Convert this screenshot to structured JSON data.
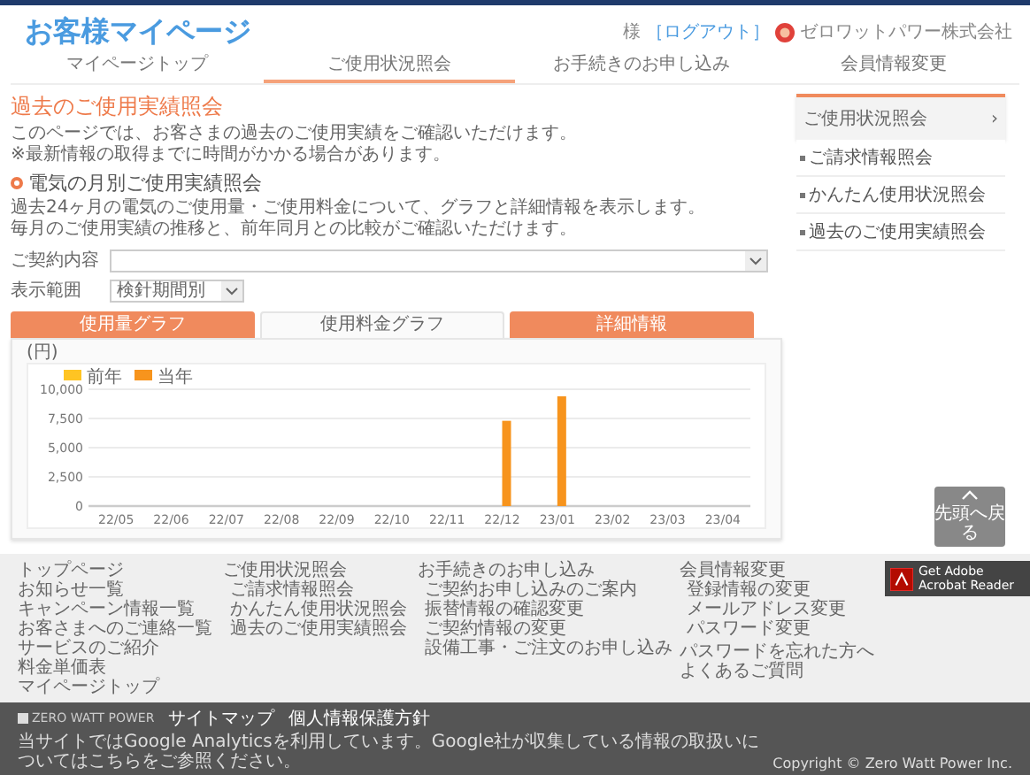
{
  "header": {
    "title": "お客様マイページ",
    "user_suffix": "様",
    "logout": "［ログアウト］",
    "company": "ゼロワットパワー株式会社"
  },
  "nav": [
    {
      "label": "マイページトップ",
      "selected": false
    },
    {
      "label": "ご使用状況照会",
      "selected": true
    },
    {
      "label": "お手続きのお申し込み",
      "selected": false
    },
    {
      "label": "会員情報変更",
      "selected": false
    }
  ],
  "page_title": "過去のご使用実績照会",
  "intro": [
    "このページでは、お客さまの過去のご使用実績をご確認いただけます。",
    "※最新情報の取得までに時間がかかる場合があります。"
  ],
  "section_title": "電気の月別ご使用実績照会",
  "section_text": [
    "過去24ヶ月の電気のご使用量・ご使用料金について、グラフと詳細情報を表示します。",
    "毎月のご使用実績の推移と、前年同月との比較がご確認いただけます。"
  ],
  "contract_select": {
    "label": "ご契約内容"
  },
  "range_select": {
    "label": "表示範囲",
    "value": "検針期間別"
  },
  "tabs": [
    {
      "label": "使用量グラフ",
      "selected": false
    },
    {
      "label": "使用料金グラフ",
      "selected": true
    },
    {
      "label": "詳細情報",
      "selected": false
    }
  ],
  "chart_unit": "(円)",
  "chart_data": {
    "type": "bar",
    "categories": [
      "22/05",
      "22/06",
      "22/07",
      "22/08",
      "22/09",
      "22/10",
      "22/11",
      "22/12",
      "23/01",
      "23/02",
      "23/03",
      "23/04"
    ],
    "series": [
      {
        "name": "前年",
        "color": "#ffc423",
        "values": [
          0,
          0,
          0,
          0,
          0,
          0,
          0,
          0,
          0,
          0,
          0,
          0
        ]
      },
      {
        "name": "当年",
        "color": "#f7941d",
        "values": [
          0,
          0,
          0,
          0,
          0,
          0,
          0,
          7300,
          9400,
          0,
          0,
          0
        ]
      }
    ],
    "ylim": [
      0,
      10000
    ],
    "grid": true,
    "yticks": [
      {
        "value": 0,
        "label": "0"
      },
      {
        "value": 2500,
        "label": "2,500"
      },
      {
        "value": 5000,
        "label": "5,000"
      },
      {
        "value": 7500,
        "label": "7,500"
      },
      {
        "value": 10000,
        "label": "10,000"
      }
    ]
  },
  "sidebar": {
    "title": "ご使用状況照会",
    "arrow": "›",
    "items": [
      "ご請求情報照会",
      "かんたん使用状況照会",
      "過去のご使用実績照会"
    ]
  },
  "back_to_top": "先頭へ戻る",
  "footer_columns": [
    {
      "links": [
        "トップページ",
        "お知らせ一覧",
        "キャンペーン情報一覧",
        "お客さまへのご連絡一覧",
        "サービスのご紹介",
        "料金単価表",
        "マイページトップ"
      ]
    },
    {
      "heading": "ご使用状況照会",
      "links": [
        "ご請求情報照会",
        "かんたん使用状況照会",
        "過去のご使用実績照会"
      ]
    },
    {
      "heading": "お手続きのお申し込み",
      "links": [
        "ご契約お申し込みのご案内",
        "振替情報の確認変更",
        "ご契約情報の変更",
        "設備工事・ご注文のお申し込み"
      ]
    },
    {
      "heading": "会員情報変更",
      "links": [
        "登録情報の変更",
        "メールアドレス変更",
        "パスワード変更"
      ],
      "extra_links": [
        "パスワードを忘れた方へ",
        "よくあるご質問"
      ]
    }
  ],
  "adobe": {
    "line1": "Get Adobe",
    "line2": "Acrobat Reader"
  },
  "bottom_bar": {
    "brand": "ZERO WATT POWER",
    "links": [
      "サイトマップ",
      "個人情報保護方針"
    ],
    "notice": "当サイトではGoogle Analyticsを利用しています。Google社が収集している情報の取扱いについてはこちらをご参照ください。",
    "copyright": "Copyright © Zero Watt Power Inc."
  }
}
